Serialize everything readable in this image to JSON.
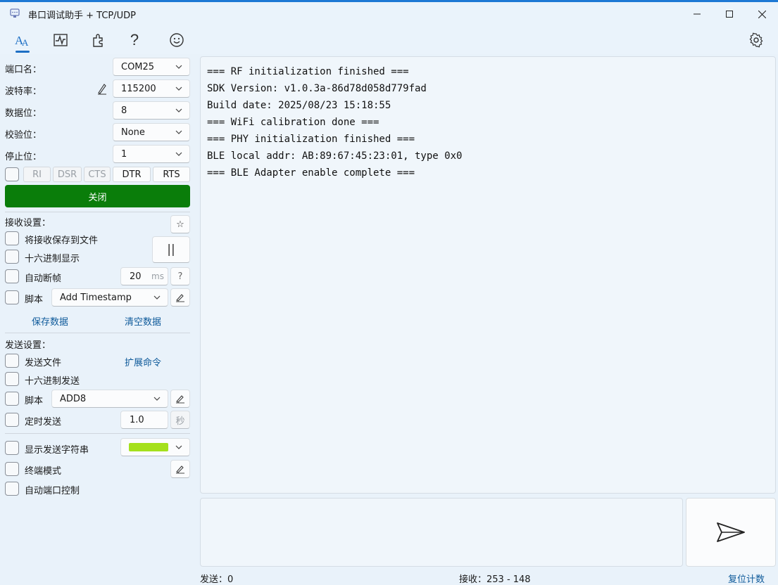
{
  "window": {
    "title": "串口调试助手 + TCP/UDP",
    "app_icon": "serial-port-icon",
    "controls": [
      "minimize-icon",
      "maximize-icon",
      "close-icon"
    ]
  },
  "toolbar": {
    "icons": [
      "font-style-icon",
      "waveform-chart-icon",
      "plugin-icon",
      "help-icon",
      "smiley-icon"
    ],
    "help_glyph": "?",
    "settings_icon": "gear-icon"
  },
  "port": {
    "port_label": "端口名：",
    "port_value": "COM25",
    "baud_label": "波特率：",
    "baud_value": "115200",
    "databits_label": "数据位：",
    "databits_value": "8",
    "parity_label": "校验位：",
    "parity_value": "None",
    "stopbits_label": "停止位：",
    "stopbits_value": "1",
    "signals": [
      "RI",
      "DSR",
      "CTS",
      "DTR",
      "RTS"
    ],
    "close_label": "关闭"
  },
  "receive": {
    "header": "接收设置：",
    "star_glyph": "☆",
    "save_to_file": "将接收保存到文件",
    "hex_display": "十六进制显示",
    "pause_glyph": "||",
    "auto_frame": "自动断帧",
    "frame_value": "20",
    "frame_unit": "ms",
    "frame_help": "?",
    "script_label": "脚本",
    "script_value": "Add Timestamp",
    "save_data": "保存数据",
    "clear_data": "清空数据"
  },
  "send": {
    "header": "发送设置：",
    "send_file": "发送文件",
    "ext_cmd": "扩展命令",
    "hex_send": "十六进制发送",
    "script_label": "脚本",
    "script_value": "ADD8",
    "timed_send": "定时发送",
    "timed_value": "1.0",
    "timed_unit": "秒",
    "show_send_str": "显示发送字符串",
    "color_swatch": "#a4e01c",
    "terminal_mode": "终端模式",
    "auto_port_ctrl": "自动端口控制"
  },
  "output": {
    "lines": [
      "=== RF initialization finished ===",
      "SDK Version: v1.0.3a-86d78d058d779fad",
      "Build date: 2025/08/23 15:18:55",
      "=== WiFi calibration done ===",
      "=== PHY initialization finished ===",
      "BLE local addr: AB:89:67:45:23:01, type 0x0",
      "=== BLE Adapter enable complete ==="
    ]
  },
  "status": {
    "sent": "发送：0",
    "received": "接收：253 - 148",
    "reset": "复位计数"
  }
}
